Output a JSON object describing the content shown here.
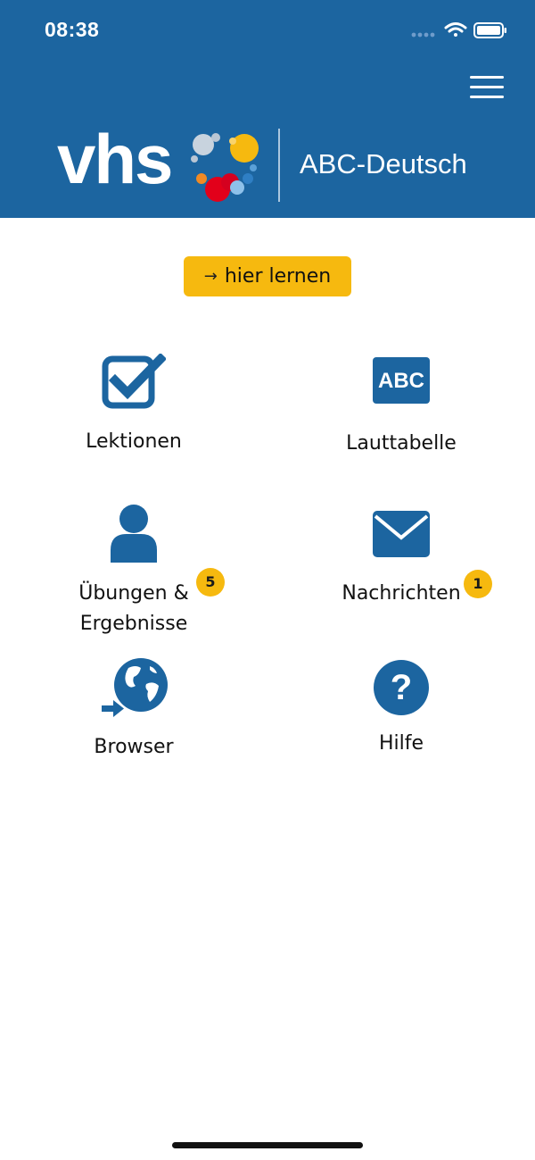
{
  "status_bar": {
    "time": "08:38"
  },
  "header": {
    "logo_text": "vhs",
    "subtitle": "ABC-Deutsch",
    "colors": {
      "background": "#1c65a0",
      "accent": "#f6b90f"
    }
  },
  "cta": {
    "arrow": "→",
    "label": "hier lernen"
  },
  "tiles": [
    {
      "id": "lektionen",
      "label": "Lektionen",
      "icon": "checkbox-icon"
    },
    {
      "id": "lauttabelle",
      "label": "Lauttabelle",
      "icon": "abc-icon",
      "icon_text": "ABC"
    },
    {
      "id": "uebungen",
      "label_line1": "Übungen &",
      "label_line2": "Ergebnisse",
      "icon": "user-icon",
      "badge": "5"
    },
    {
      "id": "nachrichten",
      "label": "Nachrichten",
      "icon": "envelope-icon",
      "badge": "1"
    },
    {
      "id": "browser",
      "label": "Browser",
      "icon": "globe-icon"
    },
    {
      "id": "hilfe",
      "label": "Hilfe",
      "icon": "help-icon"
    }
  ]
}
